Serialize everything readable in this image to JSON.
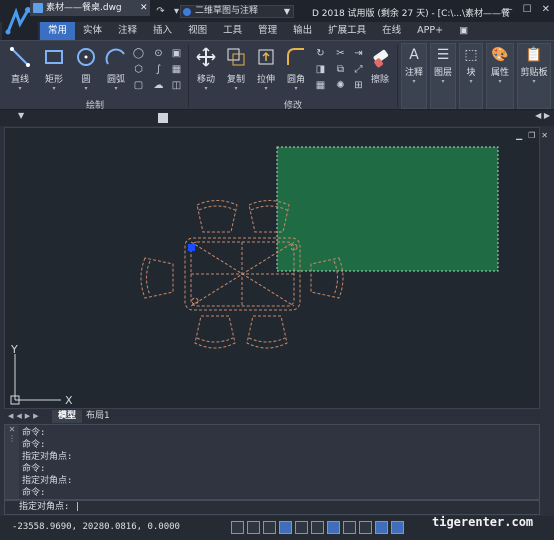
{
  "app": {
    "workspace": "二维草图与注释",
    "title": "D 2018 试用版 (剩余 27 天) - [C:\\...\\素材——餐"
  },
  "menu_tabs": [
    "常用",
    "实体",
    "注释",
    "插入",
    "视图",
    "工具",
    "管理",
    "输出",
    "扩展工具",
    "在线",
    "APP+"
  ],
  "ribbon": {
    "draw_group": "绘制",
    "modify_group": "修改",
    "draw_tools": [
      "直线",
      "矩形",
      "圆",
      "圆弧"
    ],
    "modify_tools": [
      "移动",
      "复制",
      "拉伸",
      "圆角",
      "擦除"
    ],
    "right_tools": [
      "注释",
      "图层",
      "块",
      "属性",
      "剪贴板"
    ]
  },
  "document_tab": "素材——餐桌.dwg",
  "layout_tabs": [
    "模型",
    "布局1"
  ],
  "command_history": [
    "命令:",
    "命令:",
    "指定对角点:",
    "命令:",
    "指定对角点:",
    "命令:"
  ],
  "command_prompt": "指定对角点:",
  "status": {
    "coordinates": "-23558.9690, 20280.0816, 0.0000"
  },
  "watermark": "tigerenter.com",
  "ucs": {
    "x_label": "X",
    "y_label": "Y"
  },
  "colors": {
    "accent": "#3a6fc4",
    "selection_fill": "#1f6b43",
    "selection_border": "#a8e0bc",
    "furniture_lines": "#c98a6a",
    "grip": "#1a4dff"
  }
}
